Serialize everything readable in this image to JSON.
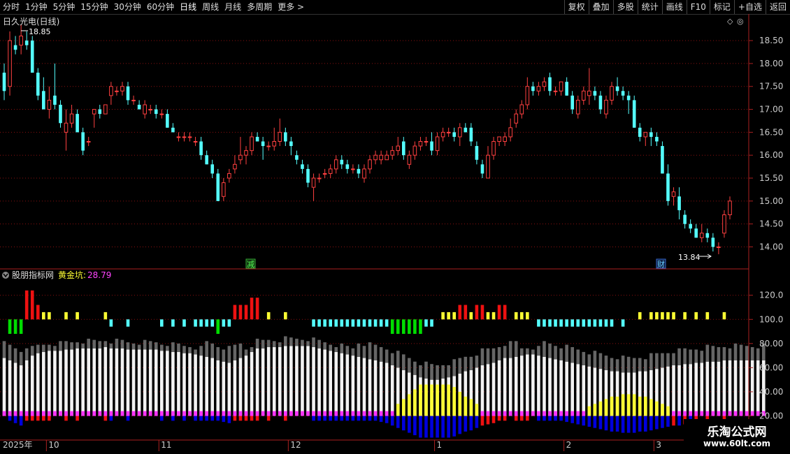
{
  "toolbar": {
    "periods": [
      "分时",
      "1分钟",
      "5分钟",
      "15分钟",
      "30分钟",
      "60分钟",
      "日线",
      "周线",
      "月线",
      "多周期",
      "更多 >"
    ],
    "active_period": "日线",
    "buttons": [
      "复权",
      "叠加",
      "多股",
      "统计",
      "画线",
      "F10",
      "标记",
      "+自选",
      "返回"
    ]
  },
  "colors": {
    "up": "#ff4040",
    "down": "#54ffff",
    "grid": "#8b1010",
    "axis": "#aa2020",
    "text": "#cccccc",
    "white_bar": "#f2f2f2",
    "gray_bar": "#666666",
    "yellow": "#ffff33",
    "magenta": "#ff33ff",
    "blue": "#0000dd",
    "red_bar": "#ee1111",
    "green": "#00dd00"
  },
  "header": {
    "title": "日久光电(日线)",
    "indicator_name": "股朋指标网",
    "indicator_param_label": "黄金坑:",
    "indicator_param_value": "28.79"
  },
  "markers": {
    "high": "18.85",
    "low": "13.84",
    "event1": "减",
    "event2": "财"
  },
  "time_axis": {
    "year": "2025年",
    "months": [
      {
        "label": "10",
        "i": 8
      },
      {
        "label": "11",
        "i": 28
      },
      {
        "label": "12",
        "i": 51
      },
      {
        "label": "1",
        "i": 77
      },
      {
        "label": "2",
        "i": 100
      },
      {
        "label": "3",
        "i": 116
      }
    ]
  },
  "watermark": {
    "name": "乐淘公式网",
    "url": "www.60lt.com"
  },
  "chart_data": [
    {
      "type": "candlestick",
      "title": "日久光电(日线)",
      "y_ticks": [
        14.0,
        14.5,
        15.0,
        15.5,
        16.0,
        16.5,
        17.0,
        17.5,
        18.0,
        18.5
      ],
      "ylim": [
        13.55,
        19.05
      ],
      "grid": true,
      "ohlc": [
        [
          17.8,
          18.0,
          17.2,
          17.4
        ],
        [
          17.5,
          18.7,
          17.3,
          18.5
        ],
        [
          18.4,
          18.6,
          18.2,
          18.3
        ],
        [
          18.4,
          18.85,
          18.2,
          18.6
        ],
        [
          18.5,
          18.7,
          18.3,
          18.4
        ],
        [
          18.5,
          18.6,
          17.8,
          17.8
        ],
        [
          17.8,
          17.9,
          17.2,
          17.3
        ],
        [
          17.4,
          17.7,
          17.0,
          17.0
        ],
        [
          17.0,
          17.5,
          16.8,
          17.2
        ],
        [
          17.3,
          18.0,
          17.0,
          17.1
        ],
        [
          17.1,
          17.2,
          16.6,
          16.7
        ],
        [
          16.5,
          17.0,
          16.1,
          16.7
        ],
        [
          16.7,
          17.1,
          16.6,
          16.9
        ],
        [
          16.9,
          17.0,
          16.5,
          16.5
        ],
        [
          16.5,
          16.6,
          16.0,
          16.1
        ],
        [
          16.3,
          16.4,
          16.2,
          16.3
        ],
        [
          16.9,
          17.0,
          16.6,
          17.0
        ],
        [
          17.0,
          17.1,
          16.8,
          16.9
        ],
        [
          16.9,
          17.1,
          16.9,
          17.1
        ],
        [
          17.3,
          17.6,
          17.1,
          17.5
        ],
        [
          17.4,
          17.5,
          17.3,
          17.4
        ],
        [
          17.4,
          17.6,
          17.3,
          17.5
        ],
        [
          17.5,
          17.6,
          17.1,
          17.2
        ],
        [
          17.2,
          17.3,
          17.1,
          17.2
        ],
        [
          17.1,
          17.2,
          17.0,
          17.0
        ],
        [
          16.9,
          17.2,
          16.8,
          17.1
        ],
        [
          17.0,
          17.1,
          16.9,
          17.0
        ],
        [
          17.0,
          17.1,
          16.8,
          16.9
        ],
        [
          16.9,
          17.0,
          16.8,
          16.9
        ],
        [
          16.9,
          17.0,
          16.6,
          16.6
        ],
        [
          16.6,
          16.7,
          16.5,
          16.5
        ],
        [
          16.4,
          16.5,
          16.3,
          16.4
        ],
        [
          16.4,
          16.5,
          16.3,
          16.4
        ],
        [
          16.4,
          16.5,
          16.3,
          16.4
        ],
        [
          16.3,
          16.4,
          16.2,
          16.3
        ],
        [
          16.3,
          16.4,
          15.9,
          16.0
        ],
        [
          16.0,
          16.1,
          15.8,
          15.8
        ],
        [
          15.8,
          15.9,
          15.5,
          15.6
        ],
        [
          15.6,
          15.7,
          15.0,
          15.0
        ],
        [
          15.1,
          15.5,
          15.0,
          15.4
        ],
        [
          15.5,
          15.7,
          15.4,
          15.6
        ],
        [
          15.7,
          16.0,
          15.6,
          15.8
        ],
        [
          15.9,
          16.4,
          15.8,
          16.0
        ],
        [
          16.0,
          16.2,
          15.8,
          16.1
        ],
        [
          16.1,
          16.5,
          16.0,
          16.4
        ],
        [
          16.4,
          16.5,
          16.3,
          16.3
        ],
        [
          16.3,
          16.4,
          15.9,
          16.2
        ],
        [
          16.2,
          16.3,
          16.1,
          16.2
        ],
        [
          16.2,
          16.6,
          16.1,
          16.3
        ],
        [
          16.3,
          16.8,
          16.2,
          16.5
        ],
        [
          16.5,
          16.6,
          16.2,
          16.3
        ],
        [
          16.3,
          16.4,
          16.0,
          16.2
        ],
        [
          16.0,
          16.1,
          15.8,
          15.9
        ],
        [
          15.8,
          15.9,
          15.6,
          15.7
        ],
        [
          15.7,
          15.8,
          15.3,
          15.4
        ],
        [
          15.3,
          15.6,
          15.0,
          15.5
        ],
        [
          15.5,
          15.6,
          15.4,
          15.5
        ],
        [
          15.6,
          15.7,
          15.5,
          15.6
        ],
        [
          15.6,
          15.8,
          15.5,
          15.7
        ],
        [
          15.7,
          16.0,
          15.6,
          15.9
        ],
        [
          15.9,
          16.0,
          15.7,
          15.8
        ],
        [
          15.8,
          15.9,
          15.6,
          15.7
        ],
        [
          15.7,
          15.8,
          15.6,
          15.7
        ],
        [
          15.7,
          15.8,
          15.5,
          15.6
        ],
        [
          15.5,
          15.8,
          15.4,
          15.7
        ],
        [
          15.7,
          16.0,
          15.6,
          15.9
        ],
        [
          15.9,
          16.1,
          15.8,
          16.0
        ],
        [
          15.9,
          16.1,
          15.8,
          16.0
        ],
        [
          15.9,
          16.1,
          15.9,
          16.0
        ],
        [
          16.0,
          16.2,
          15.9,
          16.1
        ],
        [
          16.1,
          16.4,
          16.0,
          16.2
        ],
        [
          16.3,
          16.4,
          15.9,
          16.0
        ],
        [
          15.8,
          16.1,
          15.7,
          16.0
        ],
        [
          16.0,
          16.3,
          15.9,
          16.2
        ],
        [
          16.2,
          16.4,
          16.1,
          16.3
        ],
        [
          16.3,
          16.4,
          16.2,
          16.3
        ],
        [
          16.3,
          16.5,
          16.0,
          16.1
        ],
        [
          16.1,
          16.5,
          16.0,
          16.4
        ],
        [
          16.4,
          16.6,
          16.3,
          16.5
        ],
        [
          16.5,
          16.6,
          16.4,
          16.5
        ],
        [
          16.5,
          16.6,
          16.3,
          16.4
        ],
        [
          16.4,
          16.7,
          16.2,
          16.6
        ],
        [
          16.6,
          16.7,
          16.5,
          16.5
        ],
        [
          16.6,
          16.7,
          16.2,
          16.3
        ],
        [
          16.2,
          16.3,
          15.8,
          15.9
        ],
        [
          15.8,
          15.9,
          15.5,
          15.6
        ],
        [
          15.5,
          16.2,
          15.5,
          16.0
        ],
        [
          16.0,
          16.4,
          15.9,
          16.3
        ],
        [
          16.3,
          16.4,
          16.2,
          16.4
        ],
        [
          16.3,
          16.5,
          16.2,
          16.4
        ],
        [
          16.4,
          16.8,
          16.3,
          16.6
        ],
        [
          16.7,
          17.0,
          16.6,
          16.9
        ],
        [
          16.9,
          17.2,
          16.8,
          17.1
        ],
        [
          17.1,
          17.7,
          17.0,
          17.5
        ],
        [
          17.5,
          17.6,
          17.3,
          17.4
        ],
        [
          17.4,
          17.6,
          17.3,
          17.5
        ],
        [
          17.5,
          17.7,
          17.4,
          17.6
        ],
        [
          17.7,
          17.8,
          17.3,
          17.4
        ],
        [
          17.4,
          17.5,
          17.3,
          17.4
        ],
        [
          17.4,
          17.6,
          17.3,
          17.6
        ],
        [
          17.6,
          17.7,
          17.3,
          17.3
        ],
        [
          17.3,
          17.4,
          16.9,
          17.0
        ],
        [
          16.9,
          17.3,
          16.8,
          17.2
        ],
        [
          17.2,
          17.5,
          17.1,
          17.4
        ],
        [
          17.3,
          17.9,
          17.1,
          17.4
        ],
        [
          17.4,
          17.5,
          17.2,
          17.3
        ],
        [
          17.3,
          17.4,
          16.9,
          17.0
        ],
        [
          16.9,
          17.3,
          16.8,
          17.2
        ],
        [
          17.2,
          17.6,
          17.1,
          17.5
        ],
        [
          17.5,
          17.7,
          17.3,
          17.4
        ],
        [
          17.4,
          17.5,
          17.2,
          17.3
        ],
        [
          17.3,
          17.4,
          16.9,
          17.2
        ],
        [
          17.2,
          17.3,
          16.6,
          16.6
        ],
        [
          16.6,
          16.7,
          16.3,
          16.4
        ],
        [
          16.4,
          16.5,
          16.2,
          16.5
        ],
        [
          16.5,
          16.6,
          16.2,
          16.4
        ],
        [
          16.4,
          16.5,
          16.2,
          16.3
        ],
        [
          16.2,
          16.3,
          15.6,
          15.6
        ],
        [
          15.6,
          15.8,
          14.9,
          15.0
        ],
        [
          15.1,
          15.3,
          14.9,
          15.2
        ],
        [
          15.1,
          15.3,
          14.6,
          14.8
        ],
        [
          14.7,
          14.8,
          14.4,
          14.5
        ],
        [
          14.5,
          14.6,
          14.3,
          14.4
        ],
        [
          14.4,
          14.5,
          14.2,
          14.2
        ],
        [
          14.2,
          14.5,
          14.1,
          14.3
        ],
        [
          14.3,
          14.4,
          14.1,
          14.2
        ],
        [
          14.2,
          14.3,
          13.9,
          14.0
        ],
        [
          14.0,
          14.1,
          13.84,
          14.0
        ],
        [
          14.3,
          14.8,
          14.2,
          14.7
        ],
        [
          14.7,
          15.1,
          14.6,
          15.0
        ]
      ]
    },
    {
      "type": "bar",
      "title": "股朋指标网 黄金坑: 28.79",
      "y_ticks": [
        20.0,
        40.0,
        60.0,
        80.0,
        100.0,
        120.0
      ],
      "ylim": [
        0,
        132
      ],
      "series": [
        {
          "name": "黄金坑",
          "values": [
            68,
            66,
            64,
            62,
            66,
            70,
            72,
            73,
            74,
            74,
            74,
            75,
            75,
            76,
            76,
            76,
            76,
            76,
            77,
            76,
            76,
            76,
            75,
            75,
            75,
            75,
            75,
            75,
            74,
            74,
            73,
            73,
            72,
            72,
            71,
            70,
            69,
            68,
            66,
            65,
            64,
            66,
            68,
            70,
            73,
            76,
            76,
            77,
            77,
            77,
            78,
            78,
            78,
            78,
            78,
            77,
            76,
            75,
            74,
            73,
            72,
            71,
            70,
            69,
            68,
            67,
            66,
            65,
            64,
            62,
            60,
            58,
            56,
            54,
            52,
            51,
            50,
            50,
            51,
            52,
            53,
            55,
            57,
            58,
            60,
            62,
            63,
            64,
            66,
            68,
            68,
            69,
            70,
            71,
            71,
            70,
            69,
            68,
            67,
            66,
            65,
            64,
            63,
            62,
            61,
            60,
            59,
            58,
            57,
            57,
            56,
            56,
            56,
            57,
            57,
            58,
            59,
            60,
            61,
            62,
            62,
            63,
            63,
            64,
            64,
            65,
            65,
            65,
            66,
            66,
            66,
            66,
            66,
            66,
            66,
            66
          ]
        }
      ]
    }
  ]
}
